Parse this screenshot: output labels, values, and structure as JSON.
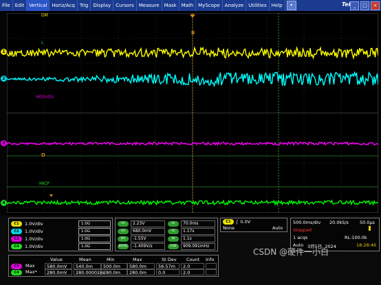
{
  "menu": {
    "items": [
      "File",
      "Edit",
      "Vertical",
      "Horiz/Acq",
      "Trig",
      "Display",
      "Cursors",
      "Measure",
      "Mask",
      "Math",
      "MyScope",
      "Analyze",
      "Utilities",
      "Help"
    ],
    "active": "Vertical",
    "dropdown_glyph": "▾",
    "brand": "Tek",
    "window_buttons": [
      "_",
      "□",
      "×"
    ]
  },
  "waveform": {
    "labels": {
      "dm": "DM",
      "l": "L",
      "mosvds": "MOSVDS",
      "mcp": "MICP"
    },
    "ch_markers": [
      "1",
      "2",
      "3",
      "4"
    ],
    "ref_markers": [
      "B",
      "D"
    ],
    "colors": {
      "ch1": "#ffff00",
      "ch2": "#00ffff",
      "ch3": "#ff00ff",
      "ch4": "#00ff00",
      "ref": "#d08a10",
      "grid": "#3a3a3a"
    }
  },
  "channels": [
    {
      "tag": "C1",
      "scale": "1.0V/div",
      "bw_label": "1.0G",
      "color": "#e8e000"
    },
    {
      "tag": "C2",
      "scale": "1.0V/div",
      "bw_label": "1.0G",
      "color": "#00d8e8"
    },
    {
      "tag": "C3",
      "scale": "1.0V/div",
      "bw_label": "1.0G",
      "color": "#e000e0"
    },
    {
      "tag": "C4",
      "scale": "1.0V/div",
      "bw_label": "1.0G",
      "color": "#20e020"
    }
  ],
  "measurements_left": [
    {
      "tag": "V1",
      "value": "2.23V"
    },
    {
      "tag": "V2",
      "value": "680.0mV"
    },
    {
      "tag": "ΔV",
      "value": "-1.55V"
    },
    {
      "tag": "ΔV/Δt",
      "value": "-1.409V/s"
    }
  ],
  "measurements_right": [
    {
      "tag": "t1",
      "value": "70.0ms"
    },
    {
      "tag": "t2",
      "value": "1.17s"
    },
    {
      "tag": "Δt",
      "value": "1.1s"
    },
    {
      "tag": "1/Δt",
      "value": "909.091mHz"
    }
  ],
  "trigger": {
    "channel": "C1",
    "slope_glyph": "∫",
    "level": "0.0V",
    "coupling": "None",
    "mode": "Auto"
  },
  "acquisition": {
    "timebase": "500.0ms/div",
    "sample_rate": "20.0kS/s",
    "resolution": "50.0µs",
    "state": "Stopped",
    "acqs": "1 acqs",
    "record_length": "RL:100.0k",
    "mode": "Auto",
    "date": "3月5日, 2024",
    "time": "18:28:46"
  },
  "stats": {
    "headers": [
      "Value",
      "Mean",
      "Min",
      "Max",
      "St Dev",
      "Count",
      "Info"
    ],
    "rows": [
      {
        "tag": "C3",
        "name": "Max",
        "cells": [
          "580.0mV",
          "540.0m",
          "500.0m",
          "580.0m",
          "56.57m",
          "2.0",
          ""
        ]
      },
      {
        "tag": "C4",
        "name": "Max*",
        "cells": [
          "280.0mV",
          "280.00002m",
          "280.0m",
          "280.0m",
          "0.0",
          "2.0",
          ""
        ]
      }
    ]
  },
  "watermark": "CSDN @硬件一小白"
}
